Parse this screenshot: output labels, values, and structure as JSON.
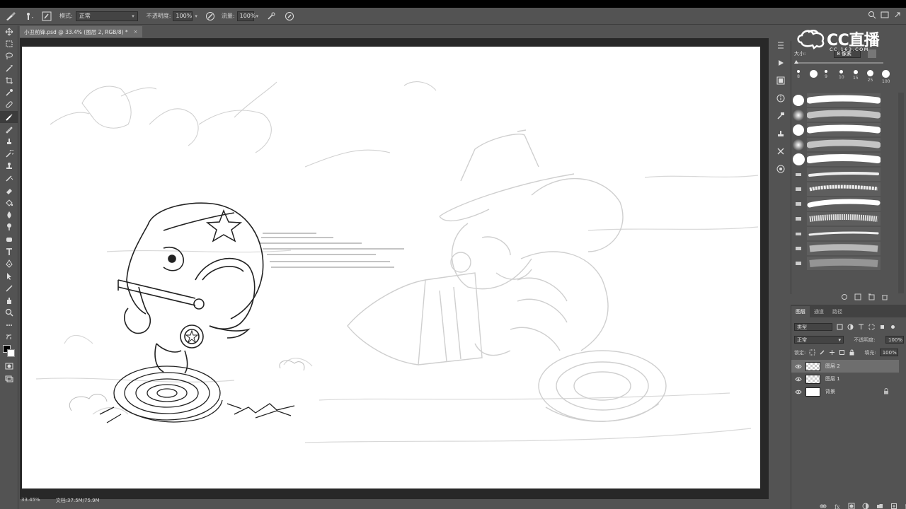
{
  "options": {
    "mode_label": "模式:",
    "mode_value": "正常",
    "opacity_label": "不透明度:",
    "opacity_value": "100%",
    "flow_label": "流量:",
    "flow_value": "100%"
  },
  "document": {
    "tab_title": "小丑前锋.psd @ 33.4% (图层 2, RGB/8) *",
    "close": "×"
  },
  "status": {
    "zoom": "33.45%",
    "doc_size": "文档:37.5M/75.9M"
  },
  "brush_panel": {
    "size_label": "大小:",
    "size_value": "8 像素",
    "preset_sizes": [
      "8",
      "9",
      "10",
      "15",
      "25",
      "100"
    ]
  },
  "layers_panel": {
    "tabs": [
      "图层",
      "通道",
      "路径"
    ],
    "filter_value": "类型",
    "blend_mode": "正常",
    "opacity_label": "不透明度:",
    "opacity_value": "100%",
    "lock_label": "锁定:",
    "fill_label": "填充:",
    "fill_value": "100%",
    "layers": [
      {
        "name": "图层 2"
      },
      {
        "name": "图层 1"
      },
      {
        "name": "背景"
      }
    ]
  },
  "watermark": {
    "brand": "CC直播",
    "url": "CC.163.COM"
  },
  "colors": {
    "ui_bg": "#535353",
    "canvas_bg": "#282828",
    "selected_layer": "#6e6e6e"
  }
}
